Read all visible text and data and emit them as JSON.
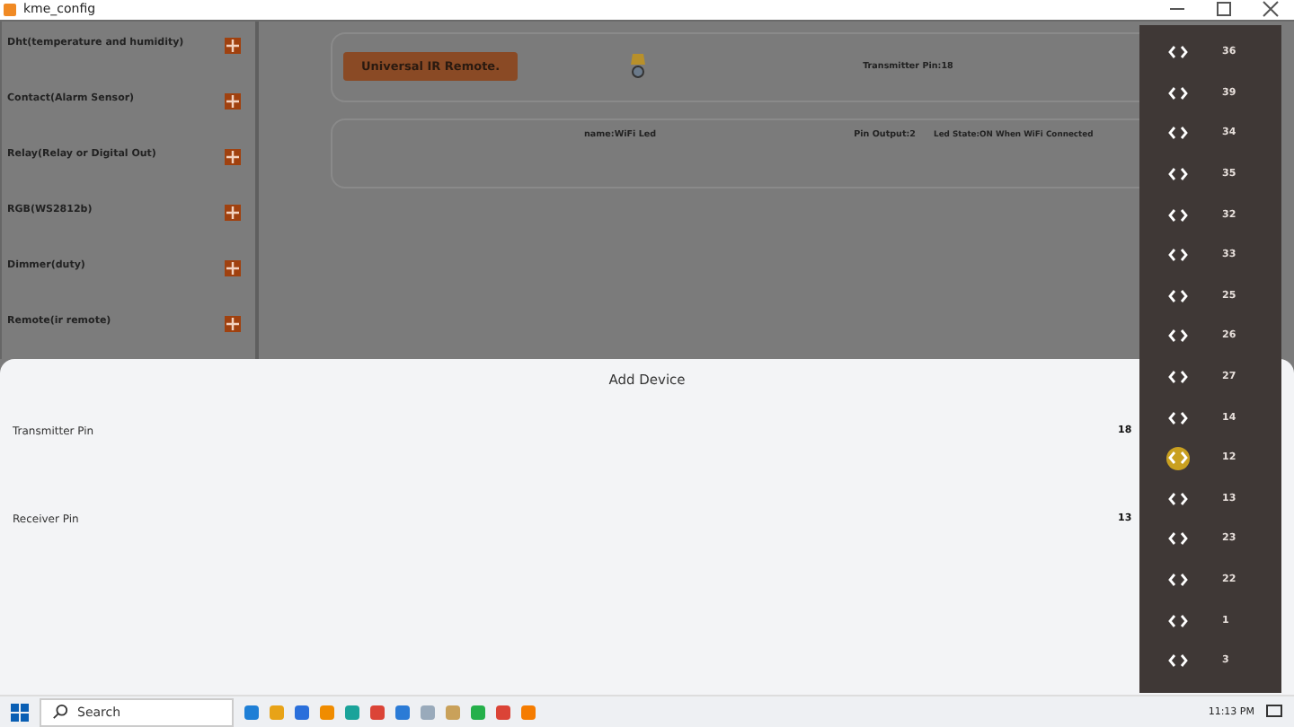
{
  "window": {
    "title": "kme_config"
  },
  "sidebar": {
    "items": [
      {
        "label": "Dht(temperature and humidity)"
      },
      {
        "label": "Contact(Alarm Sensor)"
      },
      {
        "label": "Relay(Relay or Digital Out)"
      },
      {
        "label": "RGB(WS2812b)"
      },
      {
        "label": "Dimmer(duty)"
      },
      {
        "label": "Remote(ir remote)"
      }
    ]
  },
  "devices": [
    {
      "kind": "remote",
      "button": "Universal IR Remote.",
      "fields": [
        "Transmitter Pin:18"
      ]
    },
    {
      "kind": "led",
      "fields": [
        "name:WiFi Led",
        "Pin Output:2",
        "Led State:ON When WiFi Connected"
      ]
    }
  ],
  "sheet": {
    "title": "Add Device",
    "rows": [
      {
        "label": "Transmitter Pin",
        "value": "18"
      },
      {
        "label": "Receiver Pin",
        "value": "13"
      }
    ]
  },
  "pin_menu": [
    {
      "pin": "36",
      "selected": false
    },
    {
      "pin": "39",
      "selected": false
    },
    {
      "pin": "34",
      "selected": false
    },
    {
      "pin": "35",
      "selected": false
    },
    {
      "pin": "32",
      "selected": false
    },
    {
      "pin": "33",
      "selected": false
    },
    {
      "pin": "25",
      "selected": false
    },
    {
      "pin": "26",
      "selected": false
    },
    {
      "pin": "27",
      "selected": false
    },
    {
      "pin": "14",
      "selected": false
    },
    {
      "pin": "12",
      "selected": true
    },
    {
      "pin": "13",
      "selected": false
    },
    {
      "pin": "23",
      "selected": false
    },
    {
      "pin": "22",
      "selected": false
    },
    {
      "pin": "1",
      "selected": false
    },
    {
      "pin": "3",
      "selected": false
    }
  ],
  "taskbar": {
    "search": "Search",
    "clock": "11:13 PM"
  }
}
